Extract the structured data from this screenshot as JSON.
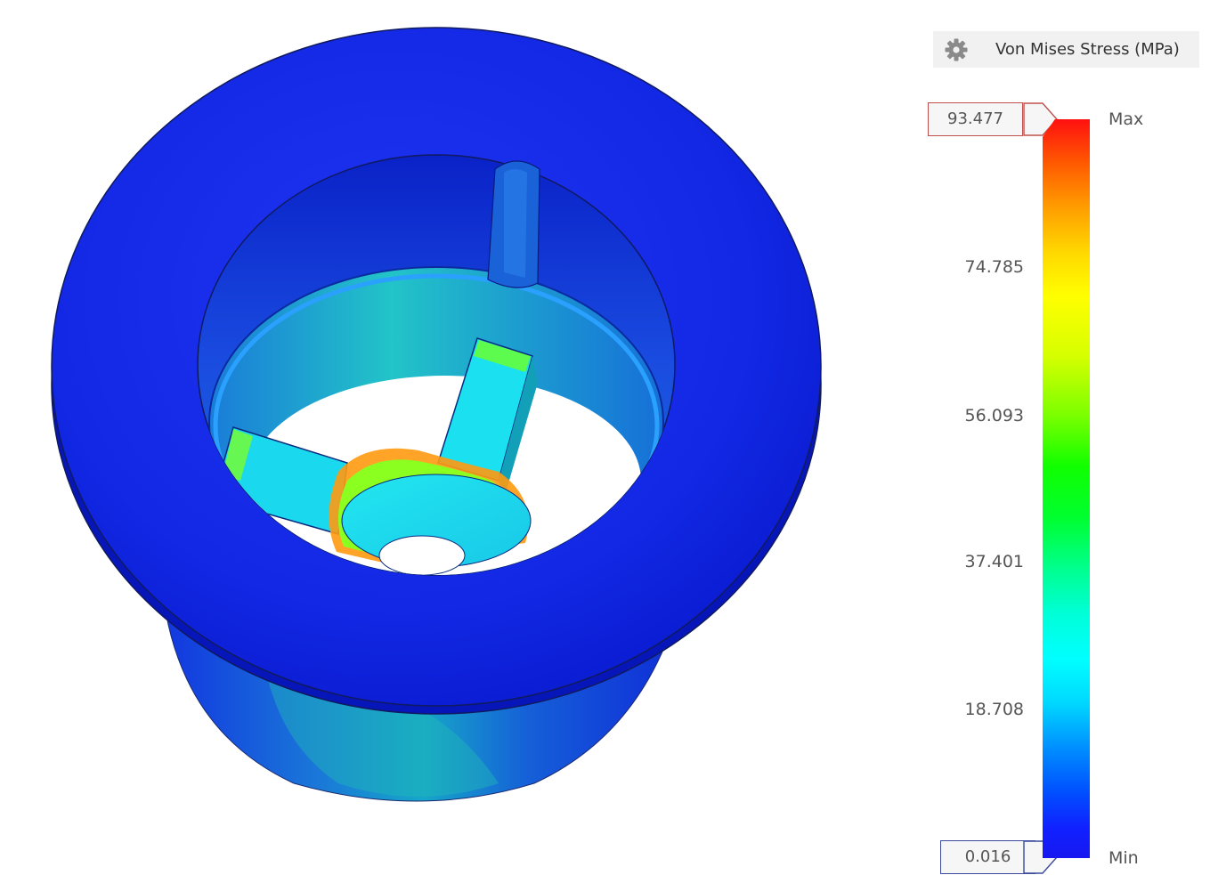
{
  "legend": {
    "title": "Von Mises Stress (MPa)",
    "settings_icon": "gear-icon",
    "max_value": "93.477",
    "min_value": "0.016",
    "max_label": "Max",
    "min_label": "Min",
    "ticks": [
      "74.785",
      "56.093",
      "37.401",
      "18.708"
    ],
    "max_border_color": "#c0504d",
    "min_border_color": "#3b4a9c"
  },
  "colors": {
    "model_blue": "#0a1fe0",
    "colormap": [
      "#ff1010",
      "#ff9e00",
      "#ffff00",
      "#10ff00",
      "#00ffff",
      "#0090ff",
      "#1818f0"
    ]
  }
}
